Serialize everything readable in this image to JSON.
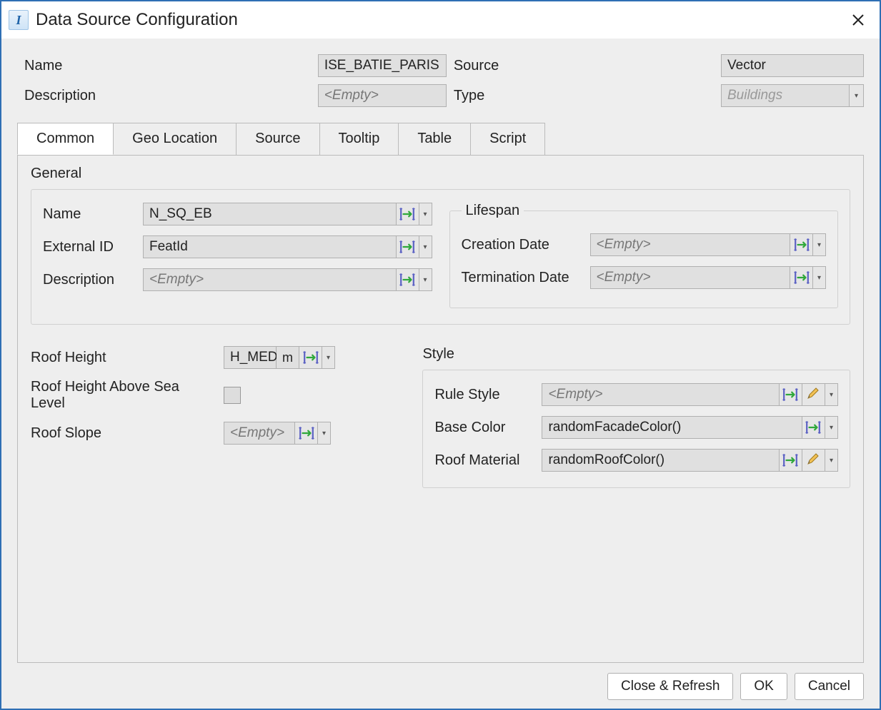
{
  "titlebar": {
    "title": "Data Source Configuration"
  },
  "header": {
    "name_label": "Name",
    "name_value": "ISE_BATIE_PARIS",
    "source_label": "Source",
    "source_value": "Vector",
    "desc_label": "Description",
    "desc_value": "<Empty>",
    "type_label": "Type",
    "type_value": "Buildings"
  },
  "tabs": {
    "common": "Common",
    "geo": "Geo Location",
    "source": "Source",
    "tooltip": "Tooltip",
    "table": "Table",
    "script": "Script"
  },
  "common": {
    "general_label": "General",
    "general": {
      "name_label": "Name",
      "name_value": "N_SQ_EB",
      "extid_label": "External ID",
      "extid_value": "FeatId",
      "desc_label": "Description",
      "desc_value": "<Empty>"
    },
    "lifespan": {
      "legend": "Lifespan",
      "creation_label": "Creation Date",
      "creation_value": "<Empty>",
      "term_label": "Termination Date",
      "term_value": "<Empty>"
    },
    "roof": {
      "height_label": "Roof Height",
      "height_value": "H_MED",
      "height_unit": "m",
      "above_label": "Roof Height Above Sea Level",
      "slope_label": "Roof Slope",
      "slope_value": "<Empty>"
    },
    "style": {
      "legend": "Style",
      "rule_label": "Rule Style",
      "rule_value": "<Empty>",
      "basecolor_label": "Base Color",
      "basecolor_value": "randomFacadeColor()",
      "roofmat_label": "Roof Material",
      "roofmat_value": "randomRoofColor()"
    }
  },
  "buttons": {
    "close_refresh": "Close & Refresh",
    "ok": "OK",
    "cancel": "Cancel"
  }
}
